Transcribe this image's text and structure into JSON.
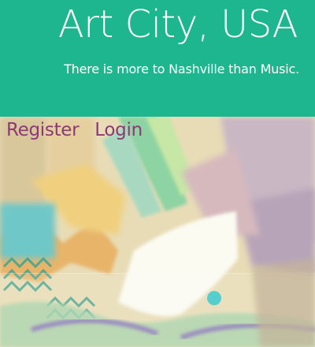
{
  "header": {
    "title": "Art City, USA",
    "tagline": "There is more to Nashville than Music.",
    "background_color": "#1db68e"
  },
  "auth_nav": {
    "register_label": "Register",
    "login_label": "Login",
    "link_color": "#8b3a73"
  },
  "hero": {
    "description": "painted artwork background image"
  }
}
